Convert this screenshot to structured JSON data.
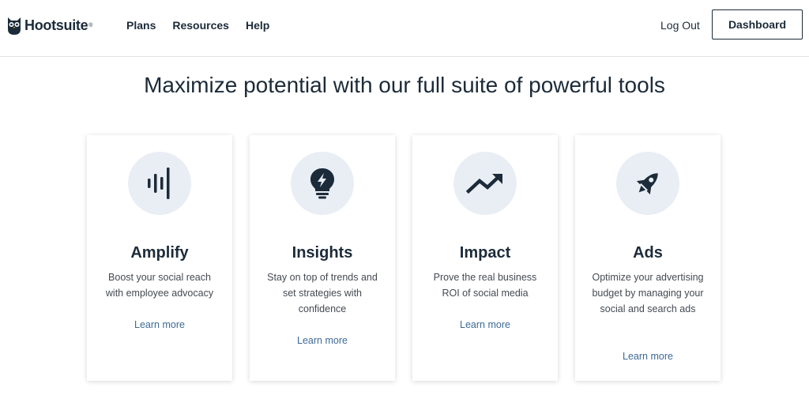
{
  "header": {
    "logo_text": "Hootsuite",
    "logo_mark": "®",
    "nav": [
      {
        "label": "Plans"
      },
      {
        "label": "Resources"
      },
      {
        "label": "Help"
      }
    ],
    "logout_label": "Log Out",
    "dashboard_label": "Dashboard"
  },
  "main": {
    "headline": "Maximize potential with our full suite of powerful tools",
    "cards": [
      {
        "icon": "sound-bars-icon",
        "title": "Amplify",
        "description": "Boost your social reach with employee advocacy",
        "link": "Learn more"
      },
      {
        "icon": "lightbulb-icon",
        "title": "Insights",
        "description": "Stay on top of trends and set strategies with confidence",
        "link": "Learn more"
      },
      {
        "icon": "trending-up-icon",
        "title": "Impact",
        "description": "Prove the real business ROI of social media",
        "link": "Learn more"
      },
      {
        "icon": "rocket-icon",
        "title": "Ads",
        "description": "Optimize your advertising budget by managing your social and search ads",
        "link": "Learn more"
      }
    ]
  },
  "colors": {
    "navy": "#1c2b39",
    "icon_bg": "#e9eef5",
    "link": "#3d6a96"
  }
}
